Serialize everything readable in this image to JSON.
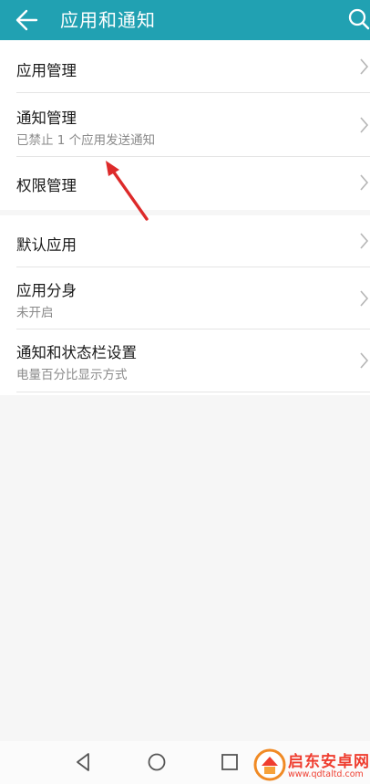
{
  "colors": {
    "header_bg": "#21a1b2",
    "header_text": "#ffffff",
    "page_bg": "#f6f6f6",
    "annotation_arrow": "#dd2a2a",
    "watermark_text": "#ef3d2f"
  },
  "header": {
    "title": "应用和通知",
    "back_icon": "arrow-left-icon",
    "search_icon": "search-icon"
  },
  "settings_groups": [
    {
      "items": [
        {
          "title": "应用管理",
          "subtitle": ""
        },
        {
          "title": "通知管理",
          "subtitle": "已禁止 1 个应用发送通知"
        },
        {
          "title": "权限管理",
          "subtitle": ""
        }
      ]
    },
    {
      "items": [
        {
          "title": "默认应用",
          "subtitle": ""
        },
        {
          "title": "应用分身",
          "subtitle": "未开启"
        },
        {
          "title": "通知和状态栏设置",
          "subtitle": "电量百分比显示方式"
        }
      ]
    }
  ],
  "chevron_icon": "chevron-right-icon",
  "nav_bar": {
    "back_icon": "triangle-back-icon",
    "home_icon": "circle-home-icon",
    "recents_icon": "square-recents-icon"
  },
  "watermark": {
    "name": "启东安卓网",
    "url": "www.qdtaltd.com"
  }
}
